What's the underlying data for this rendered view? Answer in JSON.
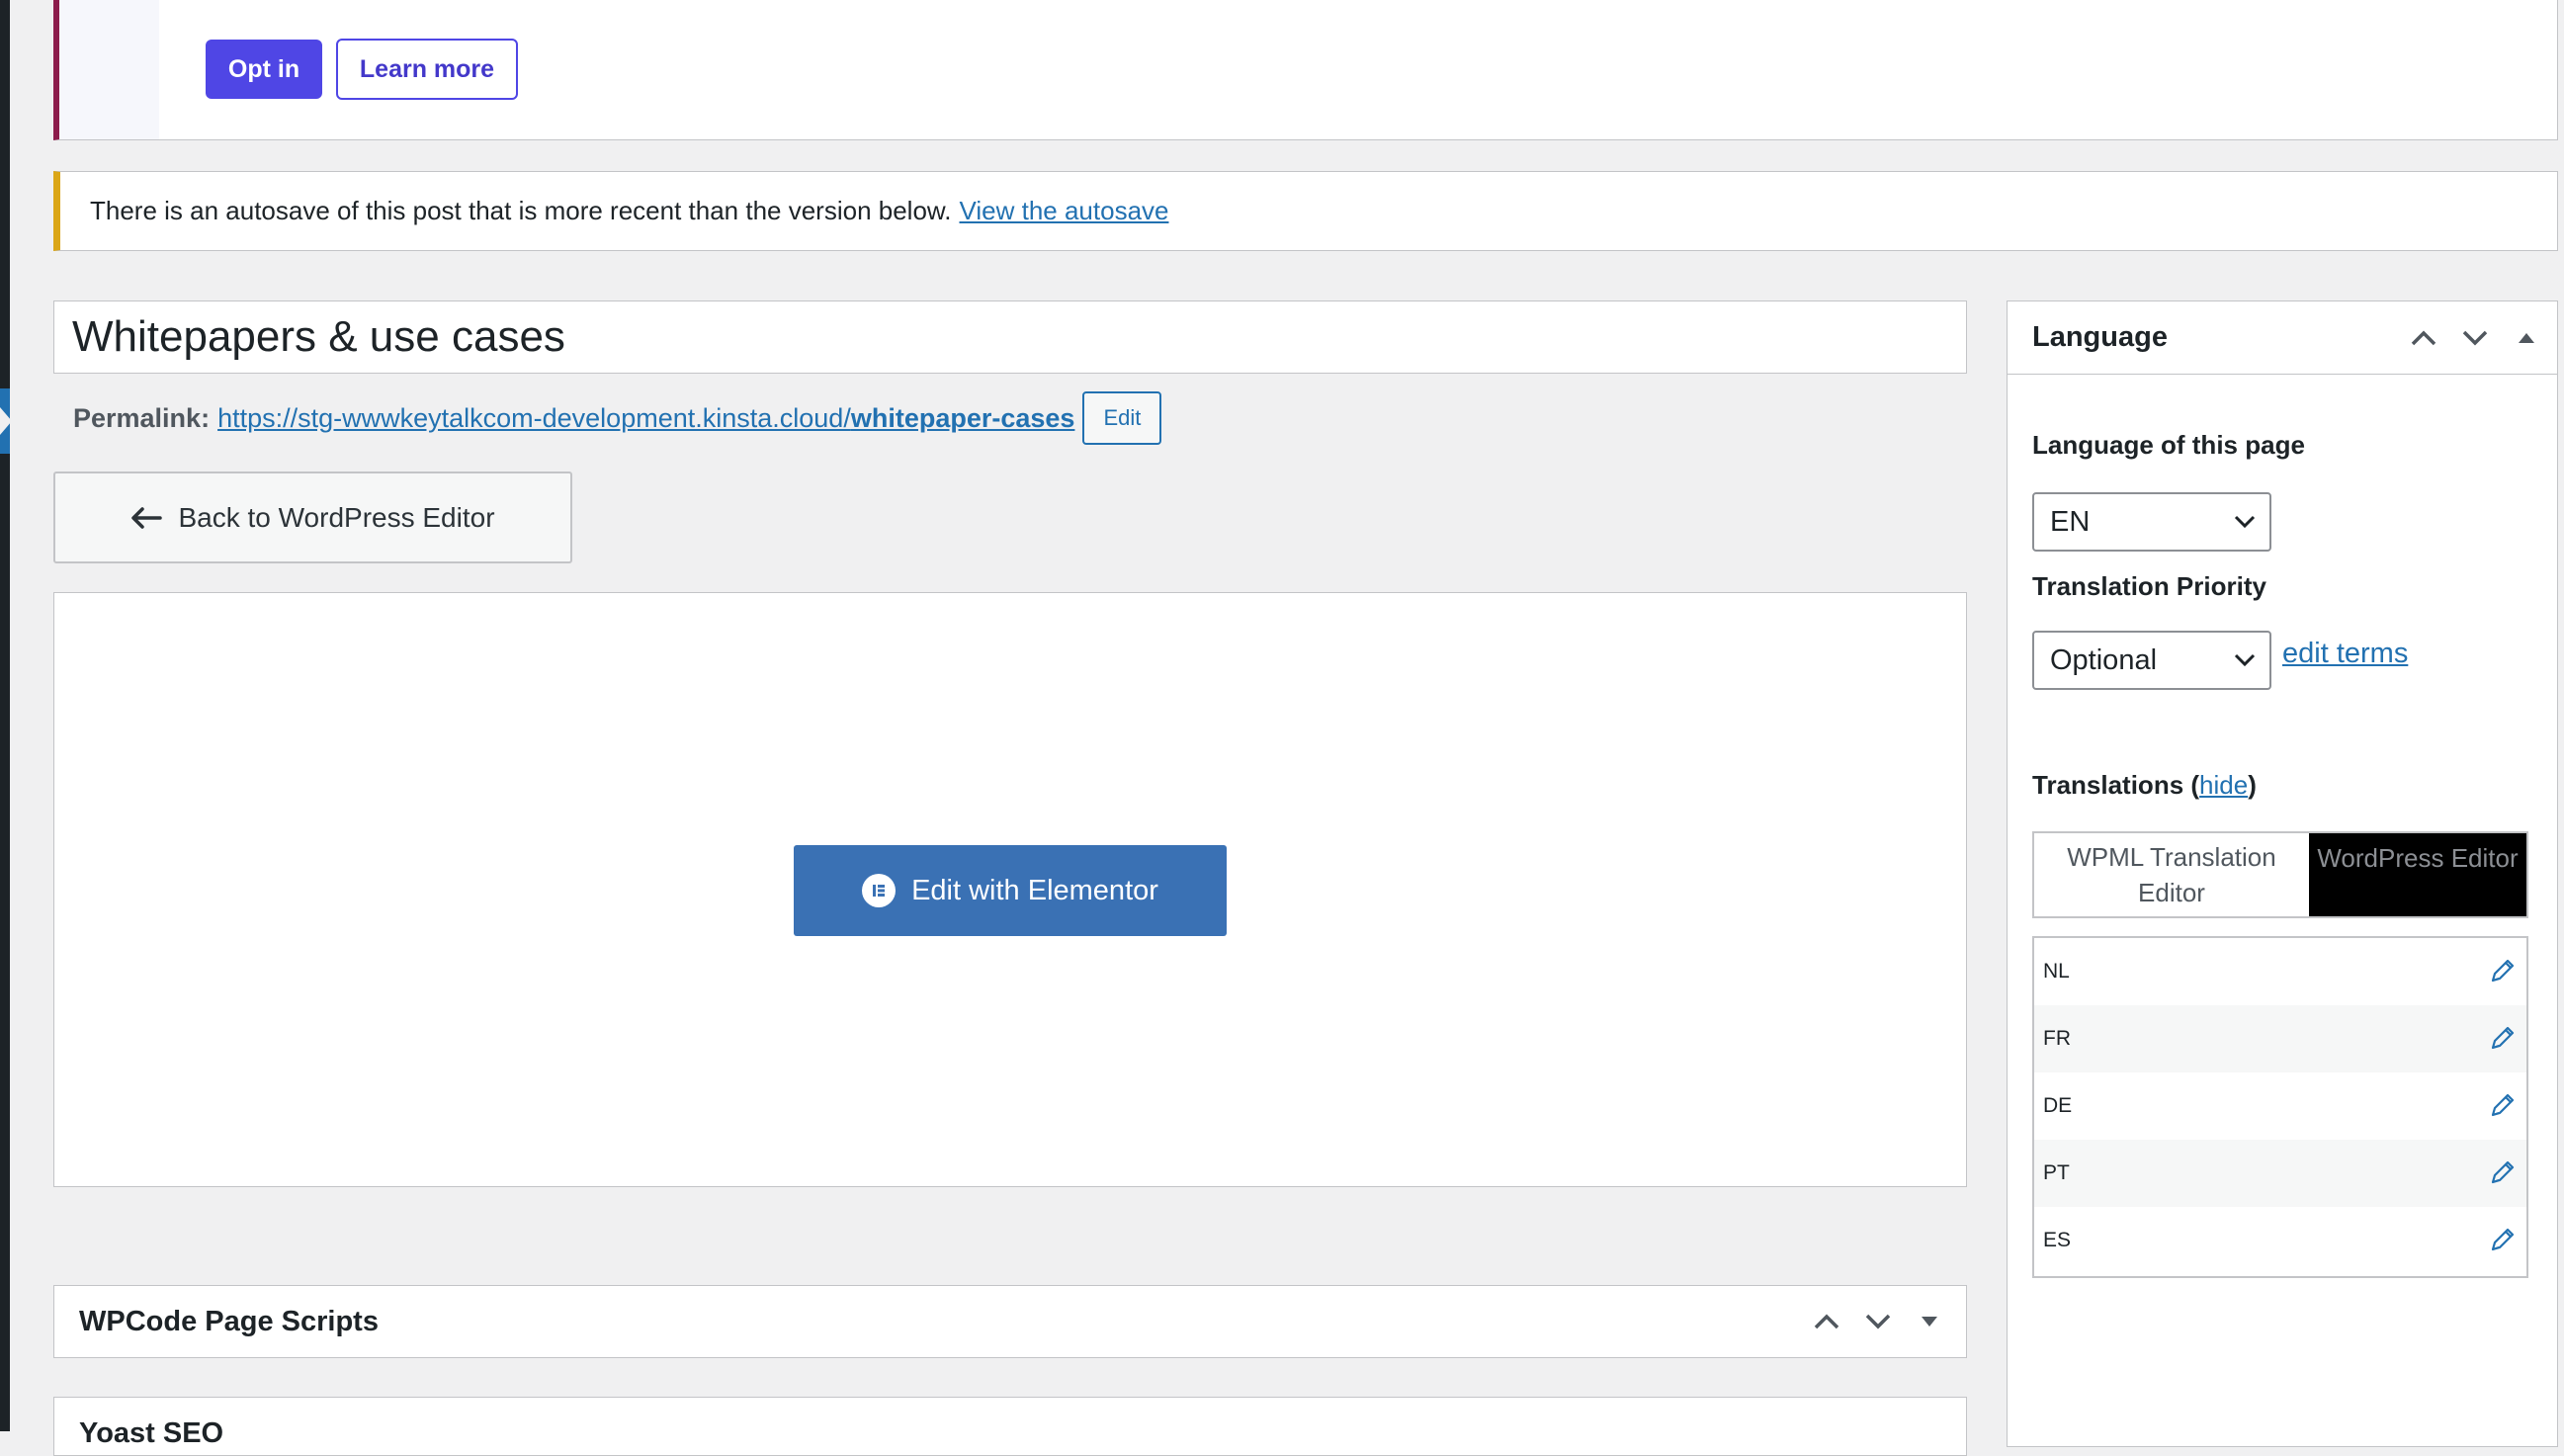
{
  "optin_notice": {
    "opt_in_label": "Opt in",
    "learn_more_label": "Learn more"
  },
  "autosave_notice": {
    "text": "There is an autosave of this post that is more recent than the version below.",
    "link_text": "View the autosave"
  },
  "post": {
    "title": "Whitepapers & use cases",
    "permalink_label": "Permalink:",
    "permalink_base": "https://stg-wwwkeytalkcom-development.kinsta.cloud/",
    "permalink_slug": "whitepaper-cases",
    "permalink_edit_label": "Edit"
  },
  "editor": {
    "back_label": "Back to WordPress Editor",
    "elementor_label": "Edit with Elementor"
  },
  "metaboxes": {
    "wpcode_title": "WPCode Page Scripts",
    "yoast_title": "Yoast SEO"
  },
  "language_panel": {
    "title": "Language",
    "language_label": "Language of this page",
    "language_value": "EN",
    "priority_label": "Translation Priority",
    "priority_value": "Optional",
    "edit_terms": "edit terms",
    "translations_label": "Translations (",
    "translations_hide": "hide",
    "translations_close": ")",
    "editor_options": {
      "wpml": "WPML Translation Editor",
      "wordpress": "WordPress Editor"
    },
    "translations": [
      {
        "code": "NL"
      },
      {
        "code": "FR"
      },
      {
        "code": "DE"
      },
      {
        "code": "PT"
      },
      {
        "code": "ES"
      }
    ]
  },
  "colors": {
    "accent": "#2271b1",
    "opt_in_purple": "#4f46e5",
    "elementor_blue": "#3a71b4",
    "notice_warning": "#dba617",
    "notice_brand": "#8c1c4c"
  },
  "icons": {
    "back": "arrow-left-icon",
    "elementor": "elementor-logo-icon",
    "move_up": "chevron-up-icon",
    "move_down": "chevron-down-icon",
    "toggle": "triangle-toggle-icon",
    "edit_translation": "pencil-icon"
  }
}
